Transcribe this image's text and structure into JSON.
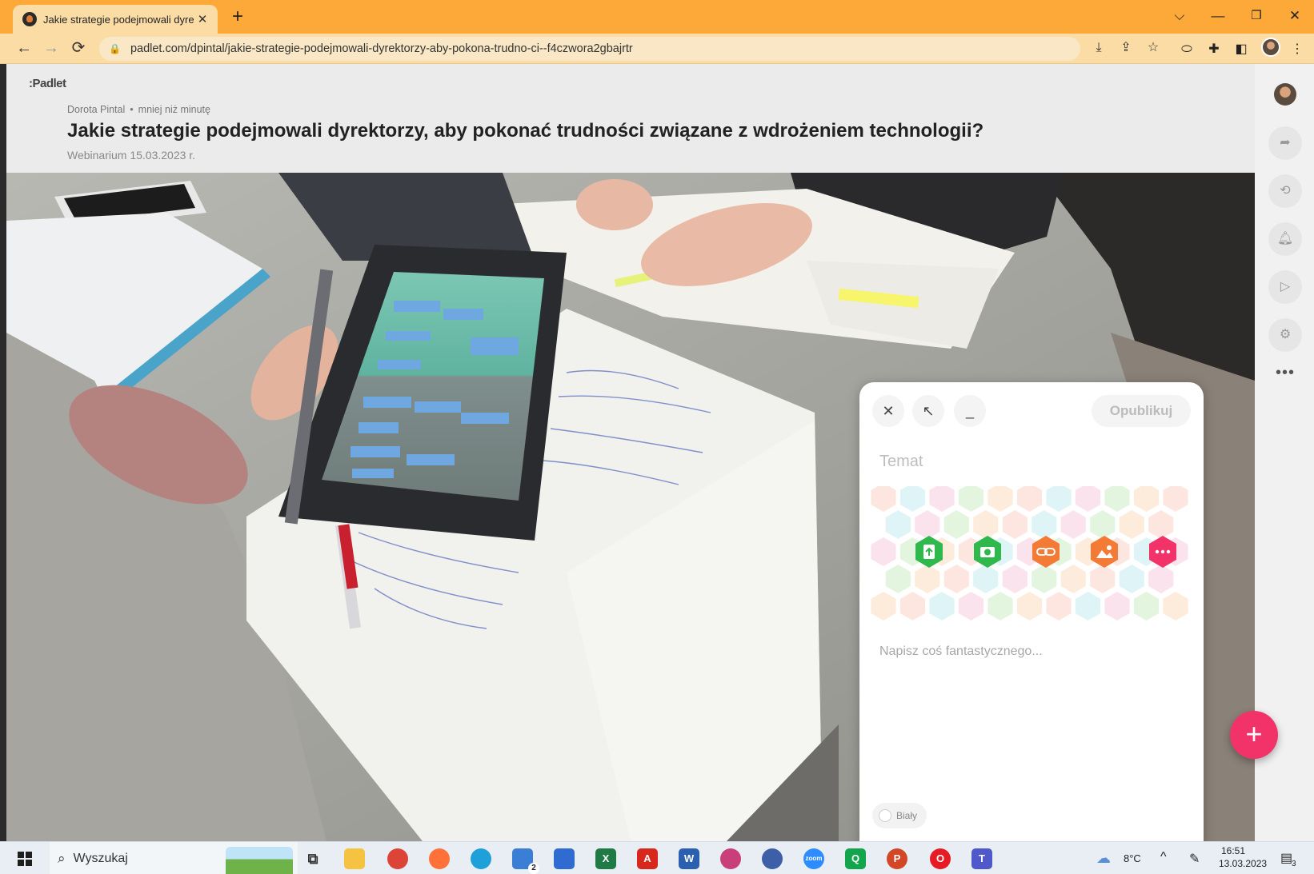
{
  "browser": {
    "tab_title": "Jakie strategie podejmowali dyre",
    "tab_close": "✕",
    "new_tab": "+",
    "url": "padlet.com/dpintal/jakie-strategie-podejmowali-dyrektorzy-aby-pokona-trudno-ci--f4czwora2gbajrtr"
  },
  "padlet": {
    "logo": ":Padlet",
    "author": "Dorota Pintal",
    "separator": "•",
    "time": "mniej niż minutę",
    "title": "Jakie strategie podejmowali dyrektorzy, aby pokonać trudności związane z wdrożeniem technologii?",
    "subtitle": "Webinarium 15.03.2023 r.",
    "sidebar_more": "•••",
    "fab_label": "+"
  },
  "composer": {
    "close": "✕",
    "expand": "↖",
    "minimize": "_",
    "publish_label": "Opublikuj",
    "subject_placeholder": "Temat",
    "body_placeholder": "Napisz coś fantastycznego...",
    "color_label": "Biały",
    "attachment_tools": [
      {
        "icon": "upload-file-icon",
        "color": "#2fb84c"
      },
      {
        "icon": "camera-icon",
        "color": "#2fb84c"
      },
      {
        "icon": "link-icon",
        "color": "#f47b35"
      },
      {
        "icon": "image-search-icon",
        "color": "#f47b35"
      },
      {
        "icon": "more-options-icon",
        "color": "#f2336a"
      }
    ]
  },
  "taskbar": {
    "search_label": "Wyszukaj",
    "weather": "8°C",
    "time": "16:51",
    "date": "13.03.2023",
    "mail_badge": "2",
    "notification_badge": "3"
  }
}
